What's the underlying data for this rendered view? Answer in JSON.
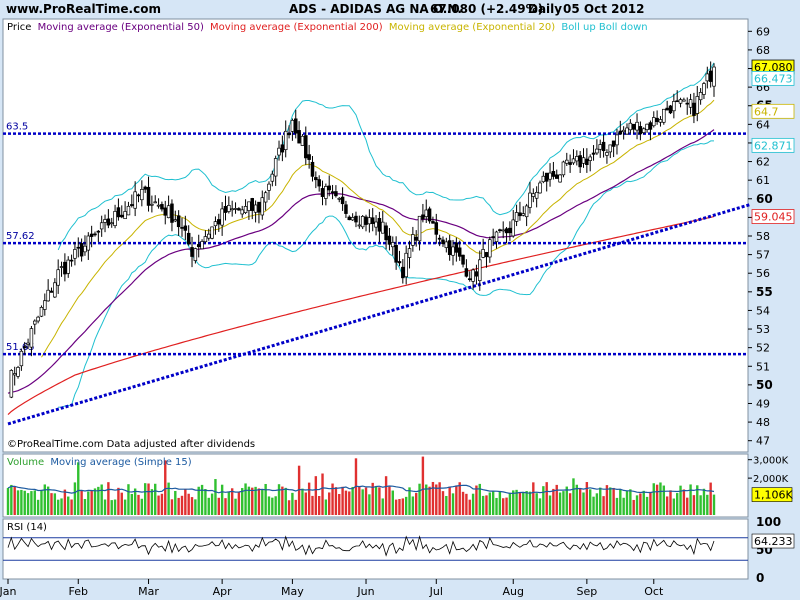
{
  "header": {
    "site": "www.ProRealTime.com",
    "instrument": "ADS - ADIDAS AG NA O.N.",
    "quote": "67.080 (+2.49%)",
    "period": "Daily",
    "date": "05 Oct 2012"
  },
  "footer_note": "©ProRealTime.com  Data adjusted after dividends",
  "colors": {
    "background": "#d6e6f6",
    "panel": "#ffffff",
    "price": "#000000",
    "ema50": "#6a0080",
    "ema200": "#e02020",
    "ema20": "#c8b400",
    "boll": "#20c0d0",
    "hline": "#0000c8",
    "vol_up": "#30c030",
    "vol_down": "#e03030",
    "vol_ma": "#1c5aa0",
    "rsi": "#000000"
  },
  "chart_data": [
    {
      "type": "candlestick",
      "panel": "price",
      "legend": [
        {
          "label": "Price",
          "color": "#000000"
        },
        {
          "label": "Moving average (Exponential 50)",
          "color": "#6a0080"
        },
        {
          "label": "Moving average (Exponential 200)",
          "color": "#e02020"
        },
        {
          "label": "Moving average (Exponential 20)",
          "color": "#c8b400"
        },
        {
          "label": "Boll up Boll down",
          "color": "#20c0d0"
        }
      ],
      "ylim": [
        46.5,
        69.5
      ],
      "yticks": [
        47,
        48,
        49,
        50,
        51,
        52,
        53,
        54,
        55,
        56,
        57,
        58,
        59,
        60,
        61,
        62,
        63,
        64,
        65,
        66,
        67,
        68,
        69
      ],
      "ytick_bold": [
        50,
        55,
        60,
        65
      ],
      "x_labels": [
        "Jan",
        "Feb",
        "Mar",
        "Apr",
        "May",
        "Jun",
        "Jul",
        "Aug",
        "Sep",
        "Oct"
      ],
      "price_anchors": [
        [
          0,
          50
        ],
        [
          5,
          52
        ],
        [
          15,
          56
        ],
        [
          30,
          58.7
        ],
        [
          40,
          60.3
        ],
        [
          50,
          59
        ],
        [
          55,
          57.2
        ],
        [
          65,
          59.3
        ],
        [
          75,
          59.5
        ],
        [
          85,
          64.3
        ],
        [
          93,
          60.6
        ],
        [
          100,
          59.5
        ],
        [
          112,
          58.4
        ],
        [
          118,
          56.2
        ],
        [
          124,
          59.2
        ],
        [
          132,
          57.4
        ],
        [
          139,
          55.8
        ],
        [
          143,
          57.3
        ],
        [
          150,
          58.4
        ],
        [
          160,
          61
        ],
        [
          170,
          61.9
        ],
        [
          178,
          62.6
        ],
        [
          185,
          63.8
        ],
        [
          192,
          64
        ],
        [
          198,
          65
        ],
        [
          205,
          64.9
        ],
        [
          211,
          67.08
        ]
      ],
      "horizontal_lines": [
        {
          "label": "63.5",
          "value": 63.5
        },
        {
          "label": "57.62",
          "value": 57.62
        },
        {
          "label": "51.65",
          "value": 51.65
        }
      ],
      "trendline": {
        "from": [
          0,
          47.9
        ],
        "to": [
          222,
          59.7
        ]
      },
      "value_tags": [
        {
          "label": "67.080",
          "value": 67.08,
          "color": "#000000",
          "fill": "#ffff00"
        },
        {
          "label": "66.473",
          "value": 66.47,
          "color": "#20c0d0",
          "fill": "#ffffff"
        },
        {
          "label": "64.7",
          "value": 64.7,
          "color": "#c8b400",
          "fill": "#ffffff"
        },
        {
          "label": "62.871",
          "value": 62.87,
          "color": "#20c0d0",
          "fill": "#ffffff"
        },
        {
          "label": "59.045",
          "value": 59.045,
          "color": "#e02020",
          "fill": "#ffffff"
        }
      ]
    },
    {
      "type": "bar",
      "panel": "volume",
      "legend": [
        {
          "label": "Volume",
          "color": "#30a030"
        },
        {
          "label": "Moving average (Simple 15)",
          "color": "#1c5aa0"
        }
      ],
      "ylim": [
        0,
        3200000
      ],
      "yticks": [
        {
          "label": "3,000K",
          "value": 3000000
        },
        {
          "label": "2,000K",
          "value": 2000000
        }
      ],
      "last_value": {
        "label": "1,106K",
        "value": 1106000
      }
    },
    {
      "type": "line",
      "panel": "rsi",
      "legend": [
        {
          "label": "RSI (14)",
          "color": "#000000"
        }
      ],
      "ylim": [
        0,
        100
      ],
      "yticks": [
        {
          "label": "100",
          "value": 100
        },
        {
          "label": "50",
          "value": 50
        },
        {
          "label": "0",
          "value": 0
        }
      ],
      "bands": [
        70,
        30
      ],
      "last_value": {
        "label": "64.233",
        "value": 64.233
      }
    }
  ]
}
